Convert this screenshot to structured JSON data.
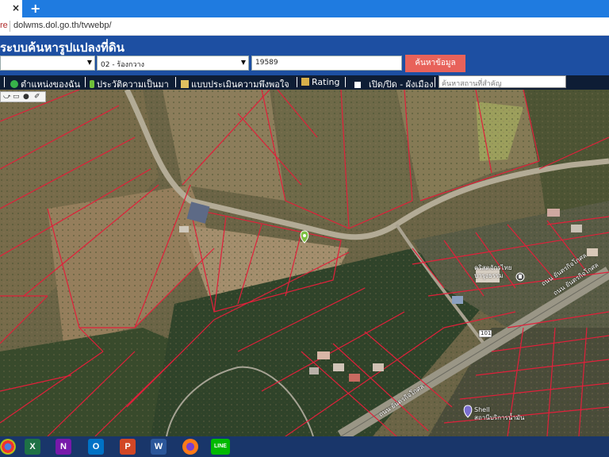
{
  "browser": {
    "tab_close": "×",
    "tab_new": "+",
    "url_prefix": "re",
    "url": "dolwms.dol.go.th/tvwebp/"
  },
  "header": {
    "title": "ระบบค้นหารูปแปลงที่ดิน",
    "province_value": "",
    "district_value": "02 - ร้องกวาง",
    "parcel_number": "19589",
    "search_button": "ค้นหาข้อมูล"
  },
  "toolbar": {
    "my_location": "ตำแหน่งของฉัน",
    "history": "ประวัติความเป็นมา",
    "survey": "แบบประเมินความพึงพอใจ",
    "rating": "Rating",
    "toggle_layer": "เปิด/ปิด - ผังเมือง",
    "place_search_placeholder": "ค้นหาสถานที่สำคัญ"
  },
  "map": {
    "labels": {
      "church": "คริสตจักรไทย\nบารุงธรรม",
      "road_right_1": "ถนน ยันตรกิจโกศล",
      "road_right_2": "ถนน ยันตรกิจโกศล",
      "road_bottom": "ถนน ยันตรกิจโกศล",
      "route_number": "101",
      "shell_station": "Shell\nสถานีบริการน้ำมัน"
    },
    "colors": {
      "parcel_line": "#e0203a",
      "marker": "#7dc142"
    }
  },
  "taskbar": {
    "apps": [
      "chrome",
      "excel",
      "onenote",
      "outlook",
      "powerpoint",
      "word",
      "firefox",
      "line"
    ],
    "app_letters": {
      "excel": "X",
      "onenote": "N",
      "outlook": "O",
      "powerpoint": "P",
      "word": "W",
      "line": "LINE"
    }
  }
}
